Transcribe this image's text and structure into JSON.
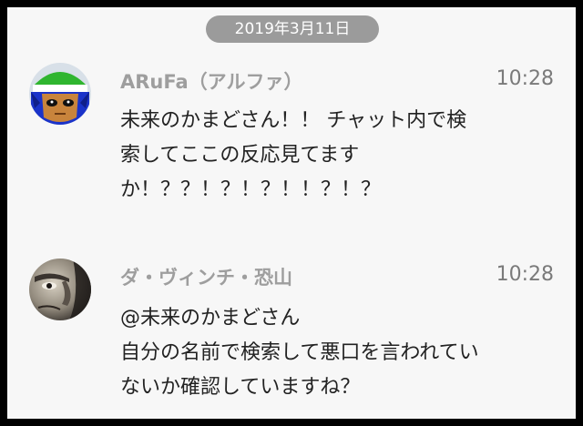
{
  "date_pill": "2019年3月11日",
  "messages": [
    {
      "name": "ARuFa（アルファ）",
      "time": "10:28",
      "lines": [
        "未来のかまどさん！！ チャット内で検",
        "索してここの反応見てます",
        "か！？？！？！？！！？！？"
      ]
    },
    {
      "name": "ダ・ヴィンチ・恐山",
      "time": "10:28",
      "lines": [
        "@未来のかまどさん",
        "自分の名前で検索して悪口を言われてい",
        "ないか確認していますね？"
      ]
    }
  ],
  "colors": {
    "background": "#f7f7f7",
    "pill": "#9b9b9b",
    "name": "#9e9e9e",
    "time": "#7a7a7a",
    "text": "#222222"
  }
}
